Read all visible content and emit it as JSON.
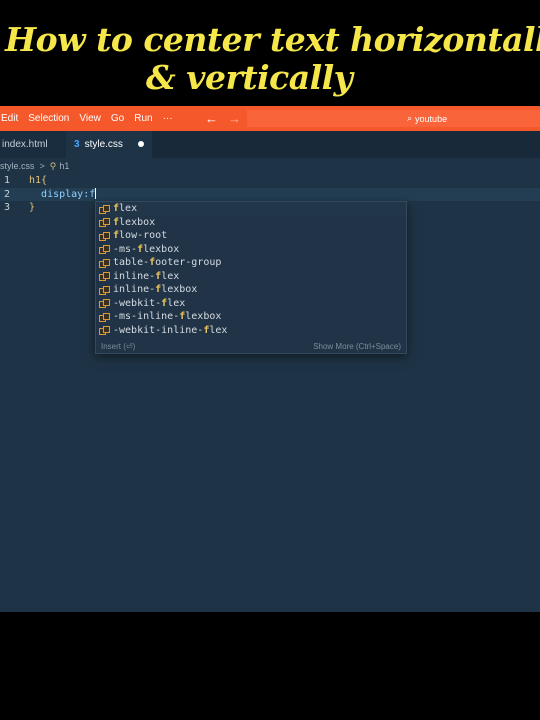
{
  "caption": {
    "line1": "How to center text horizontally",
    "line2": "& vertically",
    "color": "#f5e64a"
  },
  "menubar": {
    "items": [
      "Edit",
      "Selection",
      "View",
      "Go",
      "Run",
      "···"
    ],
    "back_arrow": "←",
    "forward_arrow": "→",
    "search_text": "youtube",
    "search_icon": "search-icon"
  },
  "tabs": [
    {
      "label": "index.html",
      "active": false
    },
    {
      "label": "style.css",
      "active": true,
      "icon": "css3-icon",
      "icon_glyph": "3"
    }
  ],
  "breadcrumb": {
    "file": "style.css",
    "separator": ">",
    "symbol": "h1"
  },
  "code": {
    "lines": [
      {
        "number": "1",
        "selector": "h1",
        "brace": "{"
      },
      {
        "number": "2",
        "indent": "  ",
        "property": "display:f"
      },
      {
        "number": "3",
        "brace": "}"
      }
    ]
  },
  "suggestions": {
    "items": [
      {
        "match": "f",
        "rest": "lex"
      },
      {
        "match": "f",
        "rest": "lexbox"
      },
      {
        "match": "f",
        "rest": "low-root"
      },
      {
        "pre": "-ms-",
        "match": "f",
        "rest": "lexbox"
      },
      {
        "pre": "table-",
        "match": "f",
        "rest": "ooter-group"
      },
      {
        "pre": "inline-",
        "match": "f",
        "rest": "lex"
      },
      {
        "pre": "inline-",
        "match": "f",
        "rest": "lexbox"
      },
      {
        "pre": "-webkit-",
        "match": "f",
        "rest": "lex"
      },
      {
        "pre": "-ms-inline-",
        "match": "f",
        "rest": "lexbox"
      },
      {
        "pre": "-webkit-inline-",
        "match": "f",
        "rest": "lex"
      }
    ],
    "footer_left": "Insert (⏎)",
    "footer_right": "Show More (Ctrl+Space)"
  },
  "colors": {
    "accent": "#f4582b",
    "editor_bg": "#1e3446",
    "match": "#e8c25c"
  }
}
